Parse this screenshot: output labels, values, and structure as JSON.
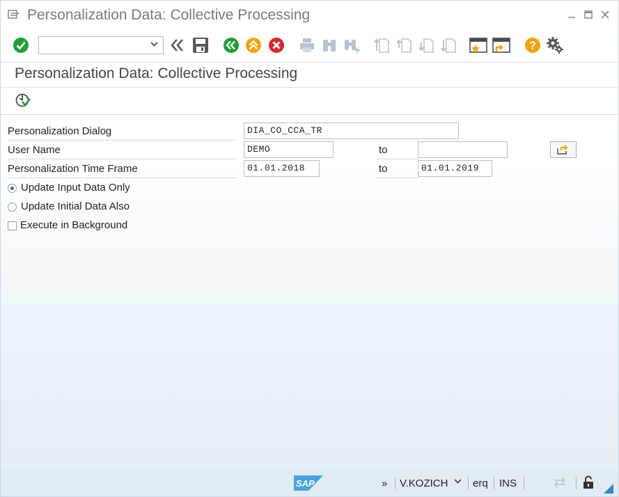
{
  "window": {
    "title": "Personalization Data: Collective Processing"
  },
  "toolbar": {
    "command_field": {
      "value": "",
      "placeholder": ""
    },
    "buttons": [
      "enter-icon",
      "command-expand-icon",
      "save-icon",
      "back-icon",
      "exit-icon",
      "cancel-icon",
      "print-icon",
      "find-icon",
      "find-next-icon",
      "first-page-icon",
      "previous-page-icon",
      "next-page-icon",
      "last-page-icon",
      "create-session-icon",
      "shortcut-icon",
      "help-icon",
      "settings-icon"
    ]
  },
  "page": {
    "heading": "Personalization Data: Collective Processing",
    "execute_icon": "execute-icon"
  },
  "form": {
    "dialog": {
      "label": "Personalization Dialog",
      "value": "DIA_CO_CCA_TR"
    },
    "user": {
      "label": "User Name",
      "from": "DEMO",
      "to_label": "to",
      "to": ""
    },
    "timeframe": {
      "label": "Personalization Time Frame",
      "from": "01.01.2018",
      "to_label": "to",
      "to": "01.01.2019"
    },
    "options": {
      "update_input": {
        "label": "Update Input Data Only",
        "selected": true
      },
      "update_initial": {
        "label": "Update Initial Data Also",
        "selected": false
      },
      "execute_background": {
        "label": "Execute in Background",
        "checked": false
      }
    }
  },
  "statusbar": {
    "logo": "SAP",
    "expand": "»",
    "user": "V.KOZICH",
    "system": "erq",
    "mode": "INS"
  },
  "colors": {
    "green": "#1e9e3a",
    "orange": "#f0a30a",
    "red": "#d9272e",
    "gray_icon": "#5a5a5a",
    "disabled_icon": "#b9c3c9",
    "sap_blue": "#4aa3df"
  }
}
